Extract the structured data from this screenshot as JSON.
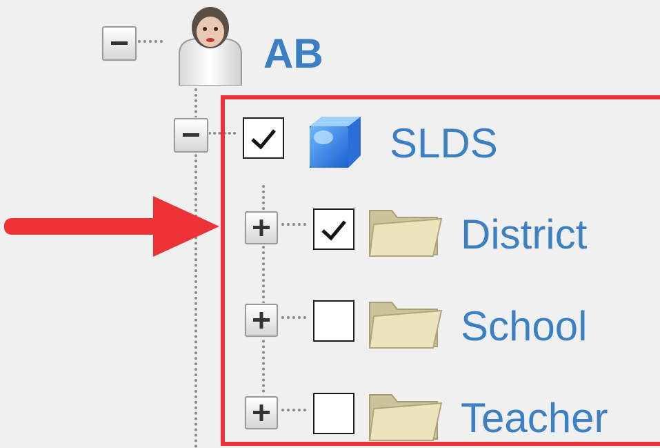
{
  "tree": {
    "root": {
      "label": "AB",
      "expanded": true,
      "icon": "user-icon"
    },
    "slds": {
      "label": "SLDS",
      "checked": true,
      "expanded": true,
      "icon": "cube-icon"
    },
    "children": [
      {
        "label": "District",
        "checked": true,
        "expanded": false,
        "icon": "folder-icon"
      },
      {
        "label": "School",
        "checked": false,
        "expanded": false,
        "icon": "folder-icon"
      },
      {
        "label": "Teacher",
        "checked": false,
        "expanded": false,
        "icon": "folder-icon"
      }
    ]
  },
  "annotations": {
    "highlight_color": "#ee3338",
    "arrow_color": "#ee3338"
  },
  "colors": {
    "label": "#3b7fc4",
    "background": "#f0f0f0"
  }
}
